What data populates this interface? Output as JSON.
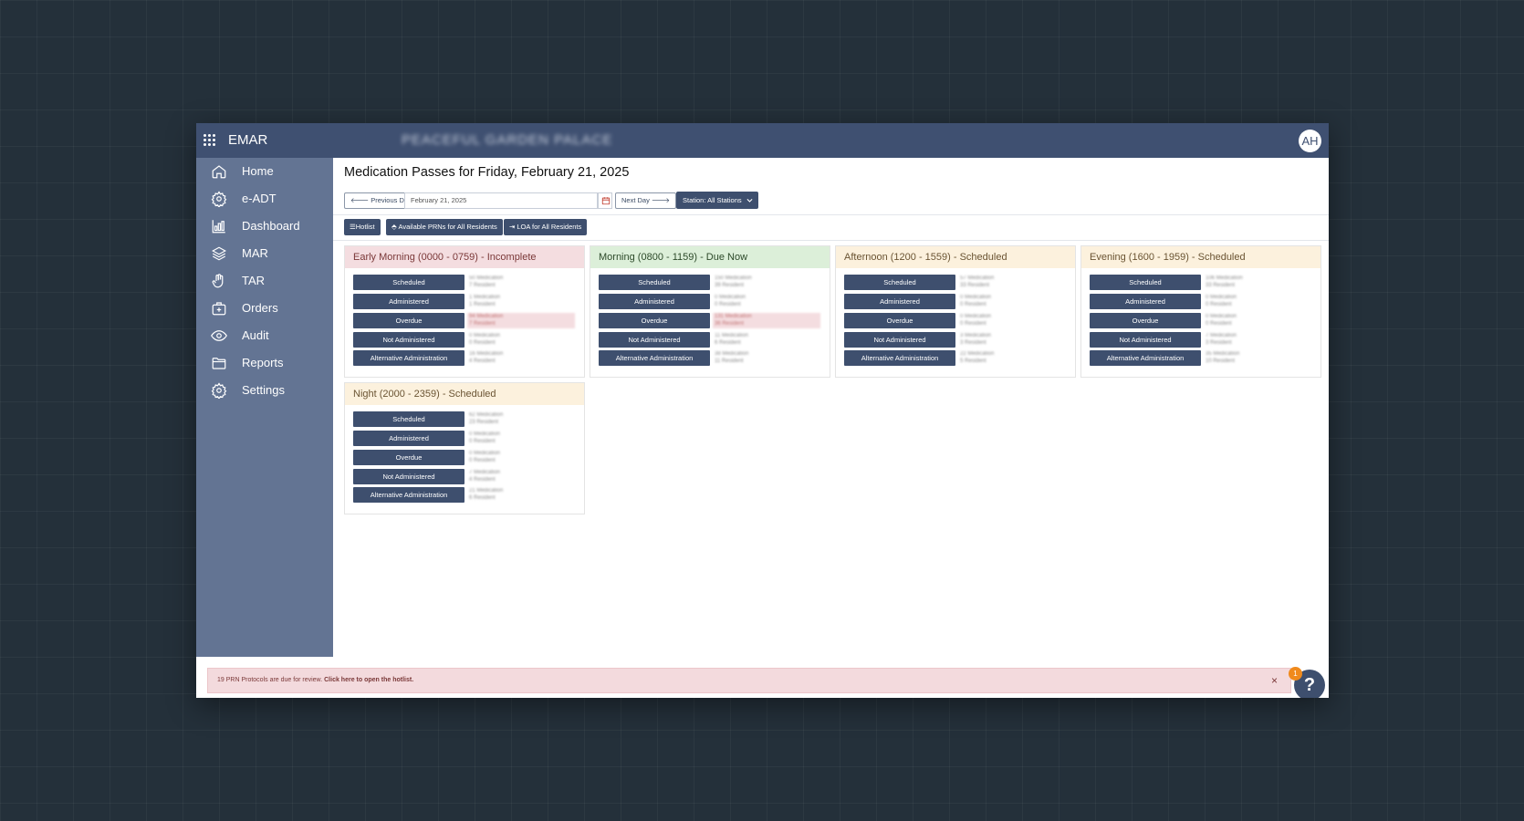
{
  "app": {
    "title": "EMAR",
    "facility": "PEACEFUL GARDEN PALACE",
    "user_initials": "AH"
  },
  "sidebar": {
    "items": [
      {
        "label": "Home",
        "icon": "home-icon"
      },
      {
        "label": "e-ADT",
        "icon": "gear-icon"
      },
      {
        "label": "Dashboard",
        "icon": "bar-chart-icon"
      },
      {
        "label": "MAR",
        "icon": "layers-icon"
      },
      {
        "label": "TAR",
        "icon": "hand-icon"
      },
      {
        "label": "Orders",
        "icon": "medical-bag-icon"
      },
      {
        "label": "Audit",
        "icon": "eye-icon"
      },
      {
        "label": "Reports",
        "icon": "folder-icon"
      },
      {
        "label": "Settings",
        "icon": "gear-icon"
      }
    ]
  },
  "main": {
    "title": "Medication Passes for Friday, February 21, 2025",
    "prev_day": "Previous Day",
    "date_value": "February 21, 2025",
    "next_day": "Next Day",
    "station_label": "Station: All Stations",
    "hotlist": "Hotlist",
    "available_prns": "Available PRNs for All Residents",
    "loa": "LOA for All Residents"
  },
  "status_labels": [
    "Scheduled",
    "Administered",
    "Overdue",
    "Not Administered",
    "Alternative Administration"
  ],
  "passes": [
    {
      "title": "Early Morning (0000 - 0759) - Incomplete",
      "status": "incomplete",
      "counts": [
        [
          "50 Medication",
          "7 Resident"
        ],
        [
          "1 Medication",
          "1 Resident"
        ],
        [
          "94 Medication",
          "7 Resident"
        ],
        [
          "0 Medication",
          "0 Resident"
        ],
        [
          "16 Medication",
          "4 Resident"
        ]
      ]
    },
    {
      "title": "Morning (0800 - 1159) - Due Now",
      "status": "due",
      "counts": [
        [
          "150 Medication",
          "39 Resident"
        ],
        [
          "0 Medication",
          "0 Resident"
        ],
        [
          "131 Medication",
          "36 Resident"
        ],
        [
          "11 Medication",
          "6 Resident"
        ],
        [
          "38 Medication",
          "11 Resident"
        ]
      ]
    },
    {
      "title": "Afternoon (1200 - 1559) - Scheduled",
      "status": "scheduled",
      "counts": [
        [
          "57 Medication",
          "33 Resident"
        ],
        [
          "0 Medication",
          "0 Resident"
        ],
        [
          "0 Medication",
          "0 Resident"
        ],
        [
          "3 Medication",
          "3 Resident"
        ],
        [
          "22 Medication",
          "5 Resident"
        ]
      ]
    },
    {
      "title": "Evening (1600 - 1959) - Scheduled",
      "status": "scheduled",
      "counts": [
        [
          "106 Medication",
          "33 Resident"
        ],
        [
          "0 Medication",
          "0 Resident"
        ],
        [
          "0 Medication",
          "0 Resident"
        ],
        [
          "7 Medication",
          "3 Resident"
        ],
        [
          "35 Medication",
          "10 Resident"
        ]
      ]
    },
    {
      "title": "Night (2000 - 2359) - Scheduled",
      "status": "scheduled",
      "counts": [
        [
          "62 Medication",
          "23 Resident"
        ],
        [
          "0 Medication",
          "0 Resident"
        ],
        [
          "0 Medication",
          "0 Resident"
        ],
        [
          "7 Medication",
          "4 Resident"
        ],
        [
          "21 Medication",
          "6 Resident"
        ]
      ]
    }
  ],
  "alert": {
    "text": "19 PRN Protocols are due for review.",
    "link": "Click here to open the hotlist.",
    "close": "×"
  },
  "help": {
    "label": "?",
    "badge": "1"
  },
  "colors": {
    "navy": "#3e4f6e",
    "sidebar": "#637493",
    "topbar": "#3f5071",
    "incomplete": "#f4dde0",
    "due": "#dcefd9",
    "scheduled": "#fcf1dd"
  }
}
